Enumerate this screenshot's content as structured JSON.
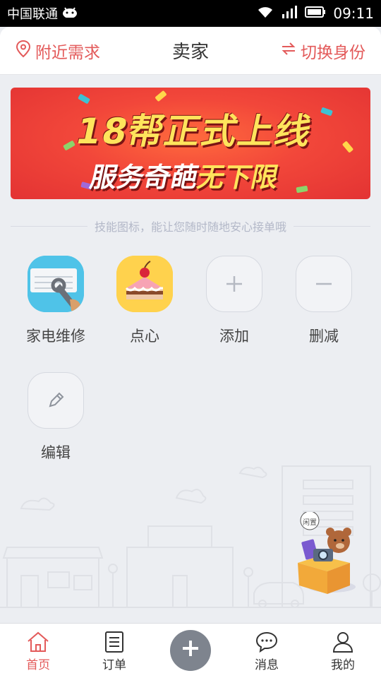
{
  "status_bar": {
    "carrier": "中国联通",
    "time": "09:11"
  },
  "header": {
    "left_label": "附近需求",
    "title": "卖家",
    "right_label": "切换身份"
  },
  "banner": {
    "line1": "18帮正式上线",
    "line2_a": "服务奇葩",
    "line2_b": "无下限"
  },
  "hint": "技能图标，能让您随时随地安心接单哦",
  "skills": [
    {
      "label": "家电维修",
      "icon": "appliance-repair-icon"
    },
    {
      "label": "点心",
      "icon": "cake-icon"
    },
    {
      "label": "添加",
      "icon": "plus-icon"
    },
    {
      "label": "删减",
      "icon": "minus-icon"
    },
    {
      "label": "编辑",
      "icon": "pencil-icon"
    }
  ],
  "decor": {
    "badge": "闲置"
  },
  "bottom_nav": [
    {
      "label": "首页",
      "icon": "home-icon",
      "active": true
    },
    {
      "label": "订单",
      "icon": "orders-icon"
    },
    {
      "label": "",
      "icon": "plus-icon"
    },
    {
      "label": "消息",
      "icon": "message-icon"
    },
    {
      "label": "我的",
      "icon": "user-icon"
    }
  ],
  "colors": {
    "accent": "#e35a5a",
    "background": "#eceef2",
    "banner": "#f2473a",
    "fab": "#7e848e"
  }
}
